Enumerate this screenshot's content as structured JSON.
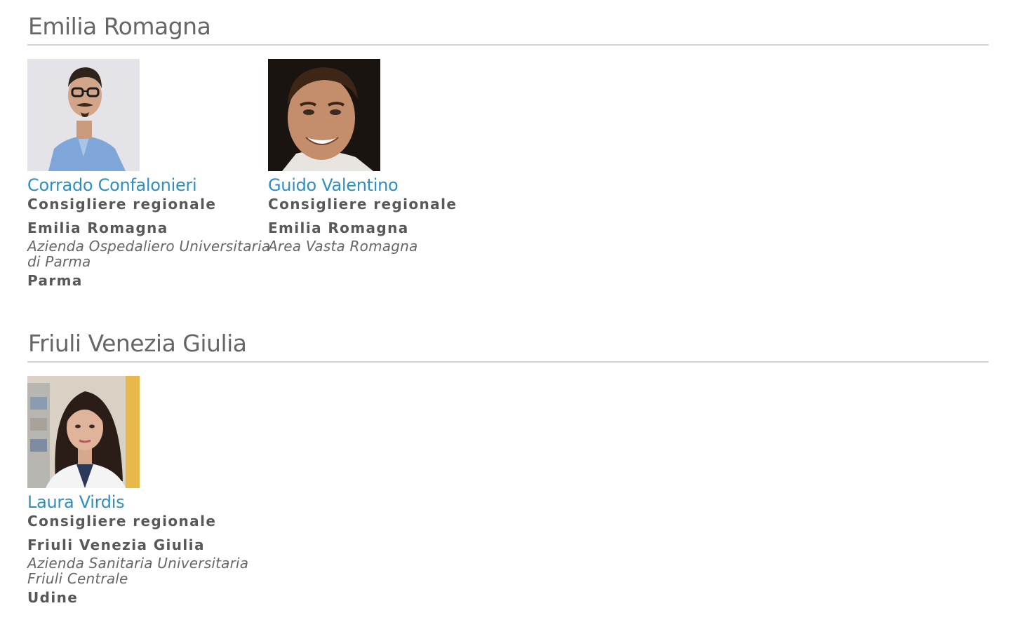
{
  "sections": [
    {
      "title": "Emilia Romagna",
      "people": [
        {
          "name": "Corrado Confalonieri",
          "role": "Consigliere regionale",
          "region": "Emilia Romagna",
          "org_line1": "Azienda Ospedaliero Universitaria",
          "org_line2": "di Parma",
          "city": "Parma"
        },
        {
          "name": "Guido Valentino",
          "role": "Consigliere regionale",
          "region": "Emilia Romagna",
          "org_line1": "Area Vasta Romagna",
          "org_line2": "",
          "city": ""
        }
      ]
    },
    {
      "title": "Friuli Venezia Giulia",
      "people": [
        {
          "name": "Laura Virdis",
          "role": "Consigliere regionale",
          "region": "Friuli Venezia Giulia",
          "org_line1": "Azienda Sanitaria Universitaria",
          "org_line2": "Friuli Centrale",
          "city": "Udine"
        }
      ]
    }
  ],
  "colors": {
    "link": "#2f8fc0",
    "rule": "#d2d2d2",
    "text": "#585858"
  }
}
